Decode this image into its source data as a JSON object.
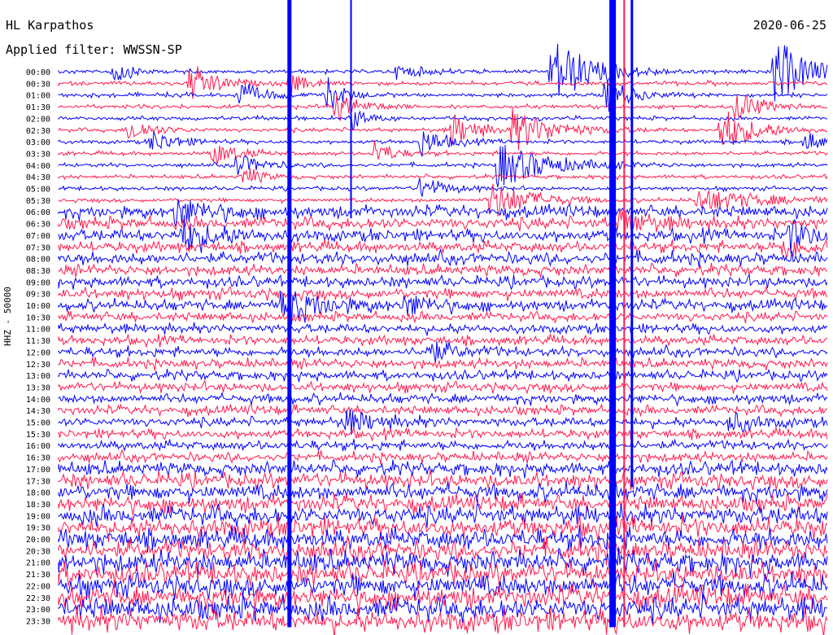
{
  "header": {
    "station": "HL Karpathos",
    "date": "2020-06-25",
    "filter": "Applied filter: WWSSN-SP",
    "channel": "HHZ - 50000"
  },
  "colors": {
    "trace_a": "#0000ff",
    "trace_b": "#ff1a4d",
    "background": "#ffffff"
  },
  "chart_data": {
    "type": "line",
    "title": "HL Karpathos",
    "ylabel": "HHZ - 50000",
    "row_labels": [
      "00:00",
      "00:30",
      "01:00",
      "01:30",
      "02:00",
      "02:30",
      "03:00",
      "03:30",
      "04:00",
      "04:30",
      "05:00",
      "05:30",
      "06:00",
      "06:30",
      "07:00",
      "07:30",
      "08:00",
      "08:30",
      "09:00",
      "09:30",
      "10:00",
      "10:30",
      "11:00",
      "11:30",
      "12:00",
      "12:30",
      "13:00",
      "13:30",
      "14:00",
      "14:30",
      "15:00",
      "15:30",
      "16:00",
      "16:30",
      "17:00",
      "17:30",
      "18:00",
      "18:30",
      "19:00",
      "19:30",
      "20:00",
      "20:30",
      "21:00",
      "21:30",
      "22:00",
      "22:30",
      "23:00",
      "23:30"
    ],
    "row_colors": [
      "blue",
      "red"
    ],
    "noise_level": [
      0.15,
      0.15,
      0.15,
      0.15,
      0.15,
      0.15,
      0.15,
      0.15,
      0.15,
      0.15,
      0.15,
      0.15,
      0.45,
      0.45,
      0.45,
      0.4,
      0.45,
      0.4,
      0.4,
      0.4,
      0.4,
      0.35,
      0.35,
      0.35,
      0.35,
      0.35,
      0.35,
      0.35,
      0.35,
      0.35,
      0.35,
      0.35,
      0.35,
      0.35,
      0.5,
      0.55,
      0.6,
      0.6,
      0.7,
      0.75,
      0.75,
      0.75,
      0.8,
      0.8,
      0.8,
      0.8,
      0.85,
      0.85
    ],
    "events": [
      {
        "row": 0,
        "x": 0.07,
        "amp": 2.5,
        "dur": 0.02
      },
      {
        "row": 0,
        "x": 0.44,
        "amp": 1.2,
        "dur": 0.03
      },
      {
        "row": 0,
        "x": 0.64,
        "amp": 6.0,
        "dur": 0.05
      },
      {
        "row": 0,
        "x": 0.93,
        "amp": 6.0,
        "dur": 0.04
      },
      {
        "row": 1,
        "x": 0.17,
        "amp": 3.5,
        "dur": 0.03
      },
      {
        "row": 1,
        "x": 0.3,
        "amp": 2.0,
        "dur": 0.02
      },
      {
        "row": 2,
        "x": 0.23,
        "amp": 2.5,
        "dur": 0.03
      },
      {
        "row": 2,
        "x": 0.35,
        "amp": 3.0,
        "dur": 0.02
      },
      {
        "row": 2,
        "x": 0.71,
        "amp": 3.0,
        "dur": 0.03
      },
      {
        "row": 3,
        "x": 0.36,
        "amp": 2.5,
        "dur": 0.03
      },
      {
        "row": 3,
        "x": 0.88,
        "amp": 3.0,
        "dur": 0.03
      },
      {
        "row": 4,
        "x": 0.38,
        "amp": 2.0,
        "dur": 0.02
      },
      {
        "row": 5,
        "x": 0.09,
        "amp": 2.0,
        "dur": 0.03
      },
      {
        "row": 5,
        "x": 0.51,
        "amp": 3.0,
        "dur": 0.03
      },
      {
        "row": 5,
        "x": 0.59,
        "amp": 3.5,
        "dur": 0.05
      },
      {
        "row": 5,
        "x": 0.86,
        "amp": 4.0,
        "dur": 0.04
      },
      {
        "row": 6,
        "x": 0.12,
        "amp": 2.0,
        "dur": 0.03
      },
      {
        "row": 6,
        "x": 0.47,
        "amp": 2.5,
        "dur": 0.03
      },
      {
        "row": 6,
        "x": 0.97,
        "amp": 2.0,
        "dur": 0.02
      },
      {
        "row": 7,
        "x": 0.2,
        "amp": 2.0,
        "dur": 0.03
      },
      {
        "row": 7,
        "x": 0.41,
        "amp": 2.5,
        "dur": 0.02
      },
      {
        "row": 8,
        "x": 0.23,
        "amp": 2.0,
        "dur": 0.03
      },
      {
        "row": 8,
        "x": 0.57,
        "amp": 4.0,
        "dur": 0.06
      },
      {
        "row": 9,
        "x": 0.24,
        "amp": 2.0,
        "dur": 0.02
      },
      {
        "row": 10,
        "x": 0.47,
        "amp": 2.0,
        "dur": 0.03
      },
      {
        "row": 11,
        "x": 0.56,
        "amp": 3.5,
        "dur": 0.05
      },
      {
        "row": 11,
        "x": 0.83,
        "amp": 2.0,
        "dur": 0.08
      },
      {
        "row": 12,
        "x": 0.15,
        "amp": 2.5,
        "dur": 0.04
      },
      {
        "row": 13,
        "x": 0.73,
        "amp": 2.5,
        "dur": 0.03
      },
      {
        "row": 14,
        "x": 0.16,
        "amp": 3.0,
        "dur": 0.04
      },
      {
        "row": 14,
        "x": 0.95,
        "amp": 2.5,
        "dur": 0.03
      },
      {
        "row": 15,
        "x": 0.94,
        "amp": 2.0,
        "dur": 0.03
      },
      {
        "row": 20,
        "x": 0.29,
        "amp": 3.0,
        "dur": 0.05
      },
      {
        "row": 20,
        "x": 0.45,
        "amp": 1.8,
        "dur": 0.03
      },
      {
        "row": 24,
        "x": 0.48,
        "amp": 2.0,
        "dur": 0.03
      },
      {
        "row": 30,
        "x": 0.37,
        "amp": 2.0,
        "dur": 0.04
      },
      {
        "row": 30,
        "x": 0.87,
        "amp": 1.8,
        "dur": 0.03
      }
    ],
    "spikes": [
      {
        "x": 0.3,
        "from_row": 0,
        "to_row": 47,
        "color": "blue",
        "width": 5
      },
      {
        "x": 0.38,
        "from_row": 0,
        "to_row": 12,
        "color": "blue",
        "width": 2
      },
      {
        "x": 0.72,
        "from_row": 0,
        "to_row": 47,
        "color": "blue",
        "width": 8
      },
      {
        "x": 0.745,
        "from_row": 0,
        "to_row": 35,
        "color": "blue",
        "width": 3
      },
      {
        "x": 0.735,
        "from_row": 0,
        "to_row": 47,
        "color": "red",
        "width": 2
      }
    ]
  }
}
